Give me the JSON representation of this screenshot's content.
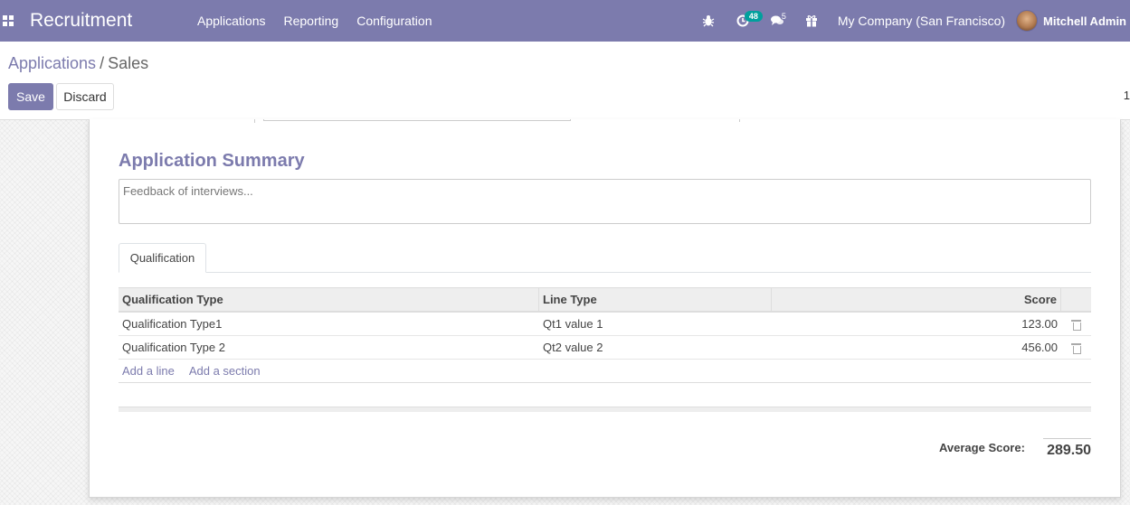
{
  "navbar": {
    "app_title": "Recruitment",
    "menu": [
      "Applications",
      "Reporting",
      "Configuration"
    ],
    "activity_count": "48",
    "messages_count": "5",
    "company": "My Company (San Francisco)",
    "user": "Mitchell Admin",
    "colors": {
      "primary": "#7c7bad",
      "badge": "#00a09d"
    }
  },
  "breadcrumb": {
    "parent": "Applications",
    "separator": "/",
    "current": "Sales"
  },
  "buttons": {
    "save": "Save",
    "discard": "Discard"
  },
  "pager": "1",
  "summary": {
    "title": "Application Summary",
    "placeholder": "Feedback of interviews..."
  },
  "tabs": [
    "Qualification"
  ],
  "table": {
    "headers": [
      "Qualification Type",
      "Line Type",
      "Score"
    ],
    "rows": [
      {
        "qualification_type": "Qualification Type1",
        "line_type": "Qt1 value 1",
        "score": "123.00"
      },
      {
        "qualification_type": "Qualification Type 2",
        "line_type": "Qt2 value 2",
        "score": "456.00"
      }
    ],
    "add_line": "Add a line",
    "add_section": "Add a section"
  },
  "average": {
    "label": "Average Score:",
    "value": "289.50"
  }
}
